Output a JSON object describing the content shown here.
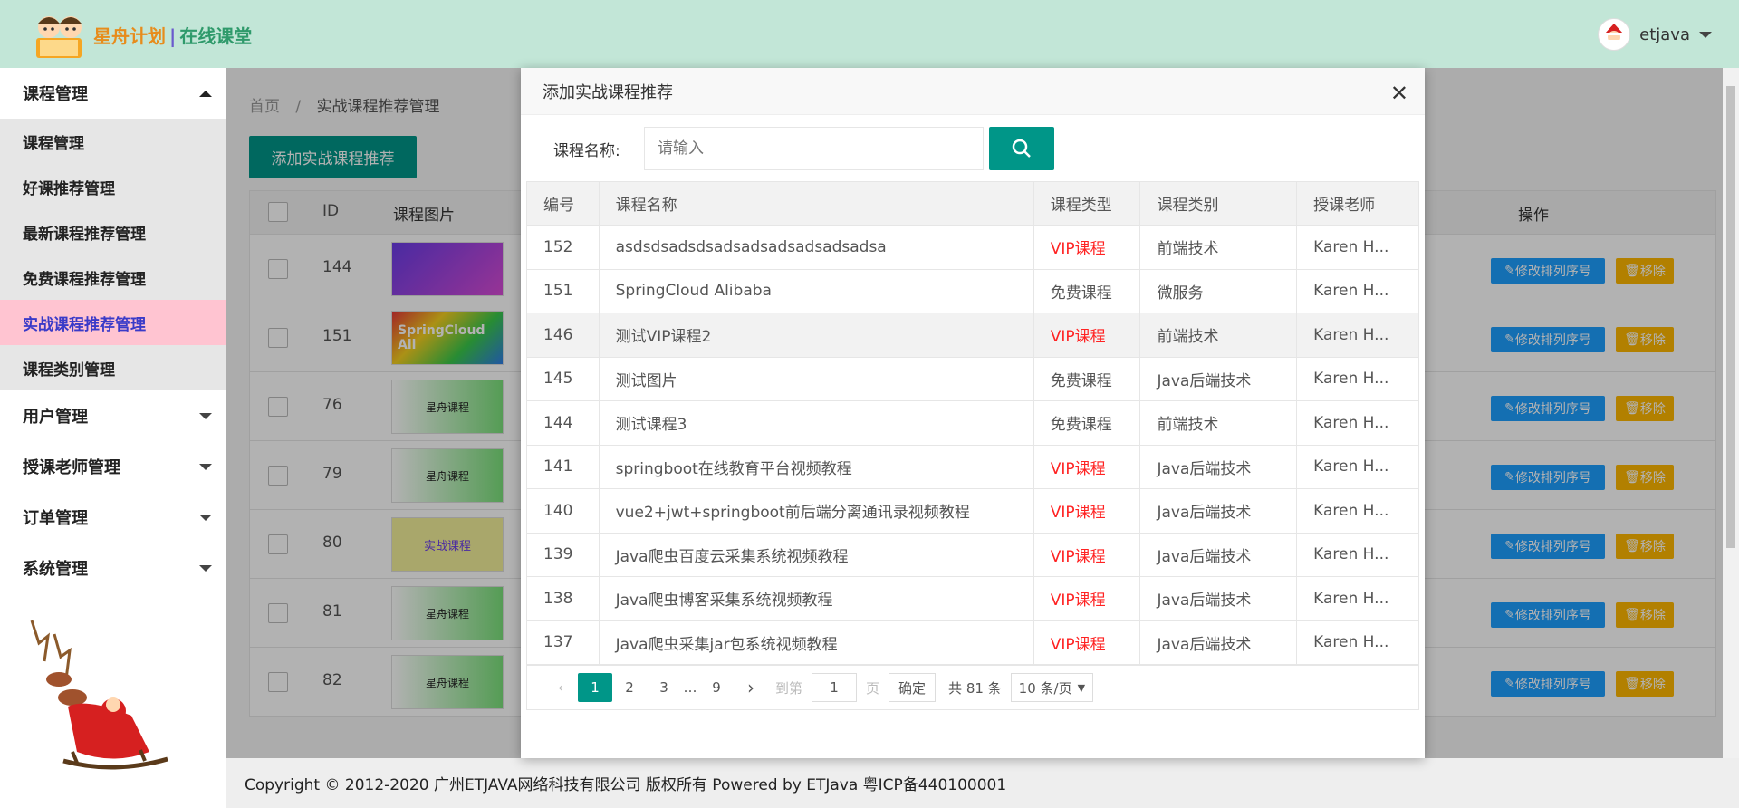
{
  "header": {
    "logo_text_a": "星舟计划",
    "logo_text_b": "在线课堂",
    "username": "etjava"
  },
  "sidebar": {
    "groups": [
      {
        "label": "课程管理",
        "open": true
      },
      {
        "label": "用户管理"
      },
      {
        "label": "授课老师管理"
      },
      {
        "label": "订单管理"
      },
      {
        "label": "系统管理"
      }
    ],
    "items": [
      "课程管理",
      "好课推荐管理",
      "最新课程推荐管理",
      "免费课程推荐管理",
      "实战课程推荐管理",
      "课程类别管理"
    ]
  },
  "main": {
    "crumb_home": "首页",
    "crumb_sep": "/",
    "crumb_current": "实战课程推荐管理",
    "add_button": "添加实战课程推荐",
    "col_id": "ID",
    "col_image": "课程图片",
    "col_op": "操作",
    "col_partial": "号",
    "rows": [
      {
        "id": "144",
        "img_label": ""
      },
      {
        "id": "151",
        "img_label": "SpringCloud Ali"
      },
      {
        "id": "76",
        "img_label": "星舟课程"
      },
      {
        "id": "79",
        "img_label": "星舟课程"
      },
      {
        "id": "80",
        "img_label": "实战课程"
      },
      {
        "id": "81",
        "img_label": "星舟课程"
      },
      {
        "id": "82",
        "img_label": "星舟课程"
      }
    ],
    "edit_label": "修改排列序号",
    "del_label": "移除"
  },
  "modal": {
    "title": "添加实战课程推荐",
    "search_label": "课程名称:",
    "search_placeholder": "请输入",
    "columns": [
      "编号",
      "课程名称",
      "课程类型",
      "课程类别",
      "授课老师"
    ],
    "rows": [
      {
        "id": "152",
        "name": "asdsdsadsdsadsadsadsadsadsadsa",
        "type": "VIP课程",
        "category": "前端技术",
        "teacher": "Karen H..."
      },
      {
        "id": "151",
        "name": "SpringCloud Alibaba",
        "type": "免费课程",
        "category": "微服务",
        "teacher": "Karen H..."
      },
      {
        "id": "146",
        "name": "测试VIP课程2",
        "type": "VIP课程",
        "category": "前端技术",
        "teacher": "Karen H..."
      },
      {
        "id": "145",
        "name": "测试图片",
        "type": "免费课程",
        "category": "Java后端技术",
        "teacher": "Karen H..."
      },
      {
        "id": "144",
        "name": "测试课程3",
        "type": "免费课程",
        "category": "前端技术",
        "teacher": "Karen H..."
      },
      {
        "id": "141",
        "name": "springboot在线教育平台视频教程",
        "type": "VIP课程",
        "category": "Java后端技术",
        "teacher": "Karen H..."
      },
      {
        "id": "140",
        "name": "vue2+jwt+springboot前后端分离通讯录视频教程",
        "type": "VIP课程",
        "category": "Java后端技术",
        "teacher": "Karen H..."
      },
      {
        "id": "139",
        "name": "Java爬虫百度云采集系统视频教程",
        "type": "VIP课程",
        "category": "Java后端技术",
        "teacher": "Karen H..."
      },
      {
        "id": "138",
        "name": "Java爬虫博客采集系统视频教程",
        "type": "VIP课程",
        "category": "Java后端技术",
        "teacher": "Karen H..."
      },
      {
        "id": "137",
        "name": "Java爬虫采集jar包系统视频教程",
        "type": "VIP课程",
        "category": "Java后端技术",
        "teacher": "Karen H..."
      }
    ],
    "pager": {
      "pages": [
        "1",
        "2",
        "3",
        "…",
        "9"
      ],
      "goto_label": "到第",
      "goto_value": "1",
      "page_unit": "页",
      "confirm": "确定",
      "total": "共 81 条",
      "page_size": "10 条/页"
    }
  },
  "footer": {
    "text": "Copyright © 2012-2020 广州ETJAVA网络科技有限公司 版权所有 Powered by ETJava 粤ICP备440100001"
  },
  "colors": {
    "header_bg": "#c2e6d7",
    "primary": "#009688",
    "vip": "#ff2222",
    "active_menu_bg": "#ffc4d1",
    "edit_btn": "#1e9fff",
    "del_btn": "#ffb800"
  }
}
